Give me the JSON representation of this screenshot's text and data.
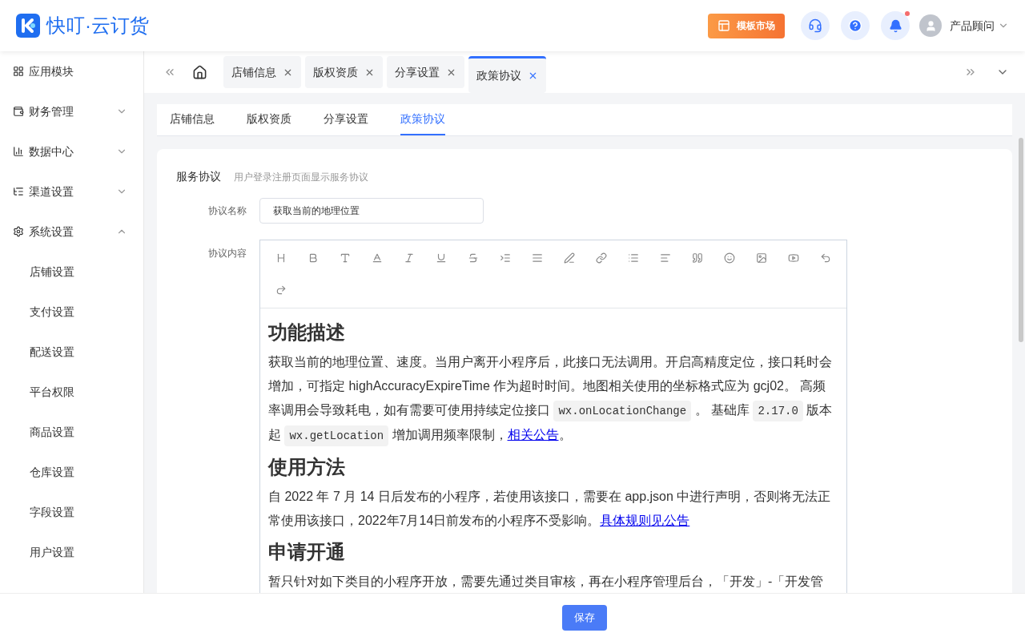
{
  "header": {
    "logo_text": "快叮·云订货",
    "template_button": "模板市场",
    "notification_dot": true,
    "user_name": "产品顾问"
  },
  "sidebar": {
    "items": [
      {
        "label": "应用模块"
      },
      {
        "label": "财务管理",
        "expanded": false
      },
      {
        "label": "数据中心",
        "expanded": false
      },
      {
        "label": "渠道设置",
        "expanded": false
      },
      {
        "label": "系统设置",
        "expanded": true,
        "children": [
          {
            "label": "店铺设置"
          },
          {
            "label": "支付设置"
          },
          {
            "label": "配送设置"
          },
          {
            "label": "平台权限"
          },
          {
            "label": "商品设置"
          },
          {
            "label": "仓库设置"
          },
          {
            "label": "字段设置"
          },
          {
            "label": "用户设置"
          }
        ]
      }
    ]
  },
  "page_tabs": [
    {
      "label": "店铺信息",
      "selected": false
    },
    {
      "label": "版权资质",
      "selected": false
    },
    {
      "label": "分享设置",
      "selected": false
    },
    {
      "label": "政策协议",
      "selected": true
    }
  ],
  "inner_tabs": [
    {
      "label": "店铺信息",
      "selected": false
    },
    {
      "label": "版权资质",
      "selected": false
    },
    {
      "label": "分享设置",
      "selected": false
    },
    {
      "label": "政策协议",
      "selected": true
    }
  ],
  "section": {
    "title": "服务协议",
    "hint": "用户登录注册页面显示服务协议"
  },
  "form": {
    "name_label": "协议名称",
    "name_value": "获取当前的地理位置",
    "content_label": "协议内容"
  },
  "editor_content": [
    {
      "kind": "heading",
      "text": "功能描述"
    },
    {
      "kind": "paragraph",
      "parts": [
        {
          "kind": "text",
          "text": "获取当前的地理位置、速度。当用户离开小程序后，此接口无法调用。开启高精度定位，接口耗时会增加，可指定 highAccuracyExpireTime 作为超时时间。地图相关使用的坐标格式应为 gcj02。 高频率调用会导致耗电，如有需要可使用持续定位接口 "
        },
        {
          "kind": "code",
          "text": "wx.onLocationChange"
        },
        {
          "kind": "text",
          "text": " 。 基础库 "
        },
        {
          "kind": "code",
          "text": "2.17.0"
        },
        {
          "kind": "text",
          "text": " 版本起 "
        },
        {
          "kind": "code",
          "text": "wx.getLocation"
        },
        {
          "kind": "text",
          "text": " 增加调用频率限制，"
        },
        {
          "kind": "link",
          "text": "相关公告"
        },
        {
          "kind": "text",
          "text": "。"
        }
      ]
    },
    {
      "kind": "heading",
      "text": "使用方法"
    },
    {
      "kind": "paragraph",
      "parts": [
        {
          "kind": "text",
          "text": "自 2022 年 7 月 14 日后发布的小程序，若使用该接口，需要在 app.json 中进行声明，否则将无法正常使用该接口，2022年7月14日前发布的小程序不受影响。"
        },
        {
          "kind": "link",
          "text": "具体规则见公告"
        }
      ]
    },
    {
      "kind": "heading",
      "text": "申请开通"
    },
    {
      "kind": "paragraph",
      "parts": [
        {
          "kind": "text",
          "text": "暂只针对如下类目的小程序开放，需要先通过类目审核，再在小程序管理后台，「开发」-「开发管"
        }
      ]
    }
  ],
  "save_button": "保存"
}
